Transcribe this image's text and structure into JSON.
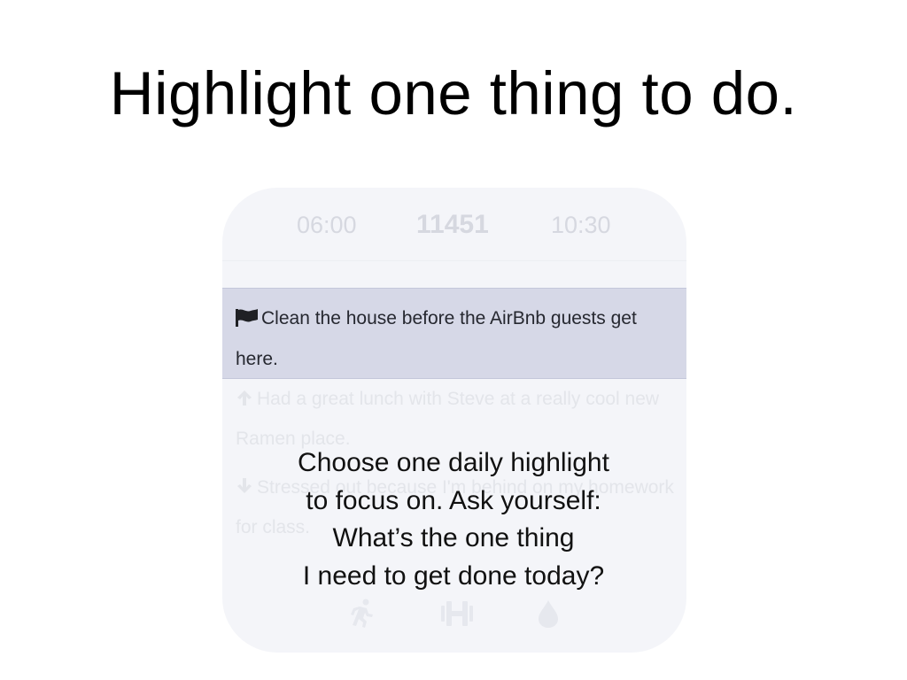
{
  "slide": {
    "title": "Highlight one thing to do."
  },
  "app": {
    "time_bar": {
      "start_time": "06:00",
      "steps": "11451",
      "end_time": "10:30"
    },
    "highlight": {
      "icon": "flag-icon",
      "text": "Clean the house before the AirBnb guests get here."
    },
    "log_entries": [
      {
        "icon": "arrow-up-icon",
        "text": "Had a great lunch with Steve at a really cool new Ramen place."
      },
      {
        "icon": "arrow-down-icon",
        "text": "Stressed out because I'm behind on my homework for class."
      }
    ],
    "bottom_icons": [
      "running-icon",
      "dumbbell-icon",
      "water-drop-icon"
    ]
  },
  "caption": {
    "lines": [
      "Choose one daily highlight",
      "to focus on. Ask yourself:",
      "What’s the one thing",
      "I need to get done today?"
    ]
  },
  "colors": {
    "highlight_background": "#d6d8e7",
    "card_background": "#f4f5f9",
    "faded_text": "#e3e5ea"
  }
}
